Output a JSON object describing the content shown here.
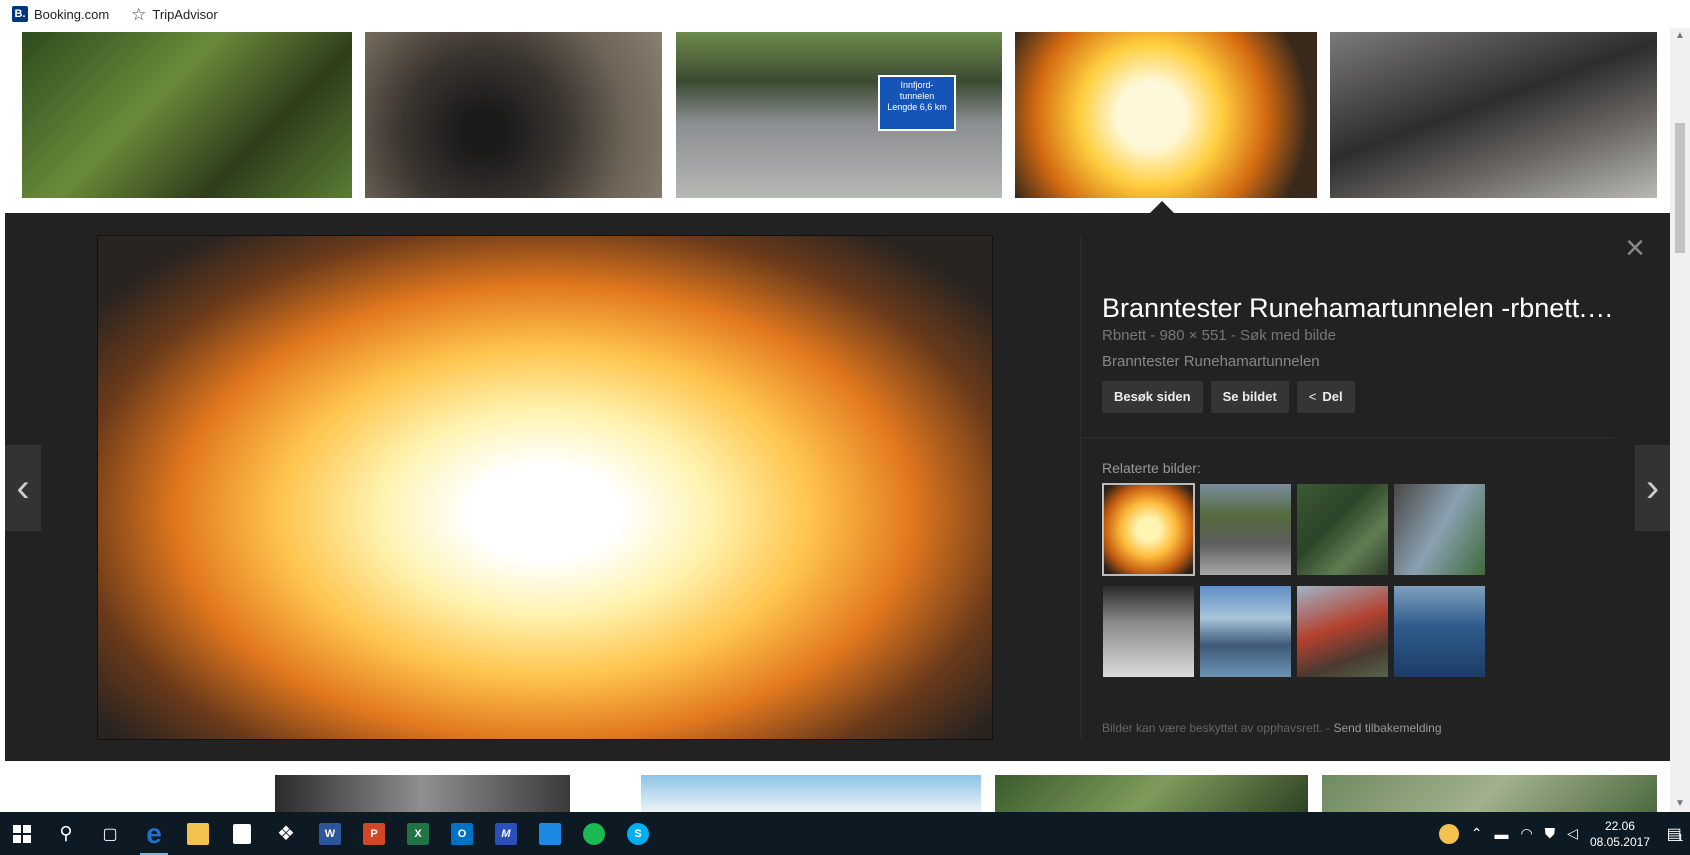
{
  "bookmarks": [
    {
      "label": "Booking.com",
      "icon": "booking-icon",
      "icon_letter": "B."
    },
    {
      "label": "TripAdvisor",
      "icon": "star-icon"
    }
  ],
  "result_thumbnails": [
    {
      "name": "forest-path"
    },
    {
      "name": "burnt-cave"
    },
    {
      "name": "tunnel-road",
      "sign_text": [
        "Innfjord-",
        "tunnelen",
        "Lengde 6,6 km"
      ]
    },
    {
      "name": "tunnel-fire"
    },
    {
      "name": "burnt-train"
    }
  ],
  "preview": {
    "title": "Branntester Runehamartunnelen -rbnett.…",
    "source": "Rbnett",
    "dimensions": "980 × 551",
    "search_link": "Søk med bilde",
    "separator": " - ",
    "description": "Branntester Runehamartunnelen",
    "buttons": {
      "visit": "Besøk siden",
      "view": "Se bildet",
      "share": "Del"
    },
    "related_label": "Relaterte bilder:",
    "footer_text": "Bilder kan være beskyttet av opphavsrett.",
    "footer_separator": " - ",
    "footer_link": "Send tilbakemelding",
    "related_images": 8
  },
  "taskbar": {
    "apps": [
      "windows-start",
      "search",
      "task-view",
      "edge",
      "file-explorer",
      "store",
      "dropbox",
      "word",
      "powerpoint",
      "excel",
      "outlook",
      "maxthon",
      "remote-desktop",
      "spotify",
      "skype"
    ],
    "time": "22.06",
    "date": "08.05.2017",
    "notification_count": "1"
  },
  "colors": {
    "panel_bg": "#222222",
    "taskbar_bg": "#0d1a24",
    "button_bg": "#353535",
    "edge_blue": "#1e73d2"
  }
}
